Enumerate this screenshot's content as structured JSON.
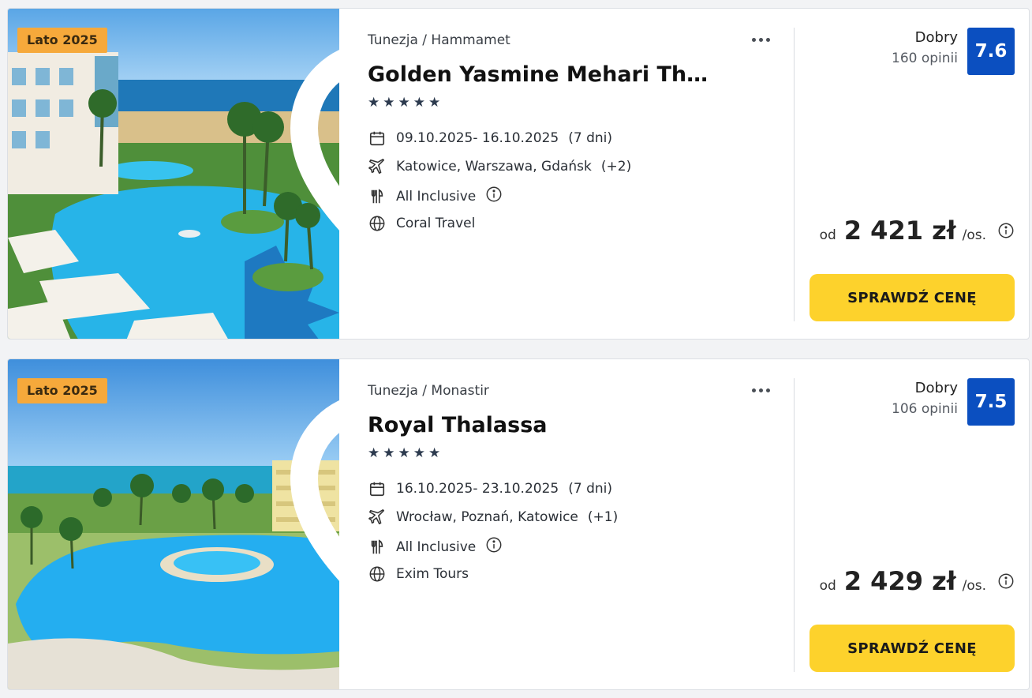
{
  "colors": {
    "badge": "#f6a93b",
    "rating_box": "#0b4fc0",
    "cta": "#fdd22c",
    "stars": "#2c3a4e"
  },
  "icons": {
    "favorite": "heart-outline-icon",
    "more": "more-horizontal-icon",
    "date": "calendar-icon",
    "departure": "plane-icon",
    "board": "utensils-icon",
    "operator": "globe-icon",
    "info": "info-circle-icon"
  },
  "offers": [
    {
      "badge": "Lato 2025",
      "location": "Tunezja / Hammamet",
      "name": "Golden Yasmine Mehari Thalassa",
      "stars": 5,
      "dates": "09.10.2025- 16.10.2025",
      "duration": "(7 dni)",
      "departures": "Katowice, Warszawa, Gdańsk",
      "departures_more": "(+2)",
      "board": "All Inclusive",
      "operator": "Coral Travel",
      "rating_word": "Dobry",
      "rating_count": "160 opinii",
      "rating_score": "7.6",
      "price_prefix": "od",
      "price": "2 421 zł",
      "price_suffix": "/os.",
      "cta": "SPRAWDŹ CENĘ"
    },
    {
      "badge": "Lato 2025",
      "location": "Tunezja / Monastir",
      "name": "Royal Thalassa",
      "stars": 5,
      "dates": "16.10.2025- 23.10.2025",
      "duration": "(7 dni)",
      "departures": "Wrocław, Poznań, Katowice",
      "departures_more": "(+1)",
      "board": "All Inclusive",
      "operator": "Exim Tours",
      "rating_word": "Dobry",
      "rating_count": "106 opinii",
      "rating_score": "7.5",
      "price_prefix": "od",
      "price": "2 429 zł",
      "price_suffix": "/os.",
      "cta": "SPRAWDŹ CENĘ"
    }
  ]
}
